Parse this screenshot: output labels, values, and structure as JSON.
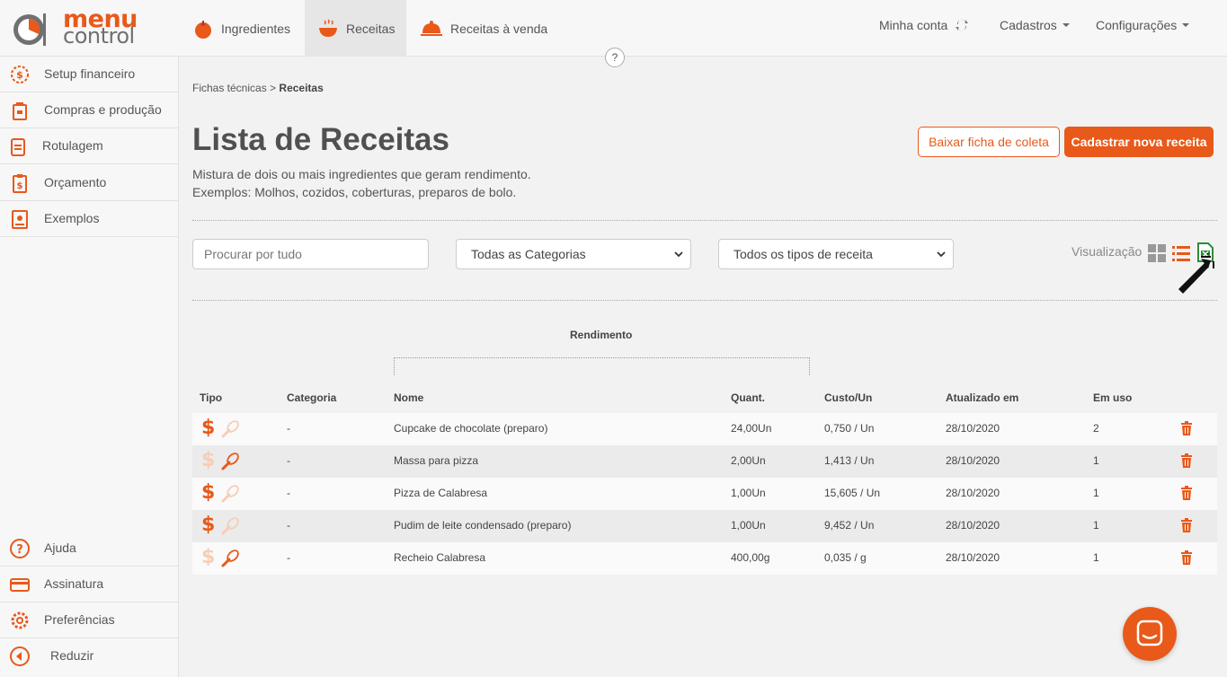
{
  "brand": {
    "line1": "menu",
    "line2": "control",
    "accent": "#e8591a"
  },
  "header": {
    "tabs": [
      {
        "label": "Ingredientes",
        "icon": "tomato-icon"
      },
      {
        "label": "Receitas",
        "icon": "cooking-pot-icon",
        "active": true
      },
      {
        "label": "Receitas à venda",
        "icon": "food-cloche-icon"
      }
    ],
    "account_label": "Minha conta",
    "cadastros_label": "Cadastros",
    "config_label": "Configurações",
    "help_label": "?"
  },
  "sidebar": {
    "top_items": [
      {
        "label": "Setup financeiro",
        "icon": "gear-dollar-icon"
      },
      {
        "label": "Compras e produção",
        "icon": "shopping-bag-icon"
      },
      {
        "label": "Rotulagem",
        "icon": "label-jar-icon"
      },
      {
        "label": "Orçamento",
        "icon": "clipboard-dollar-icon"
      },
      {
        "label": "Exemplos",
        "icon": "recipe-book-icon"
      }
    ],
    "bottom_items": [
      {
        "label": "Ajuda",
        "icon": "help-circle-icon"
      },
      {
        "label": "Assinatura",
        "icon": "credit-card-icon"
      },
      {
        "label": "Preferências",
        "icon": "gear-icon"
      },
      {
        "label": "Reduzir",
        "icon": "collapse-arrow-icon"
      }
    ]
  },
  "breadcrumb": {
    "parent": "Fichas técnicas",
    "separator": ">",
    "current": "Receitas"
  },
  "page": {
    "title": "Lista de Receitas",
    "desc1": "Mistura de dois ou mais ingredientes que geram rendimento.",
    "desc2": "Exemplos: Molhos, cozidos, coberturas, preparos de bolo.",
    "download_button": "Baixar ficha de coleta",
    "new_button": "Cadastrar nova receita"
  },
  "filters": {
    "search_placeholder": "Procurar por tudo",
    "category_selected": "Todas as Categorias",
    "type_selected": "Todos os tipos de receita",
    "view_label": "Visualização"
  },
  "table": {
    "group_header": "Rendimento",
    "headers": {
      "tipo": "Tipo",
      "categoria": "Categoria",
      "nome": "Nome",
      "quant": "Quant.",
      "custo": "Custo/Un",
      "atualizado": "Atualizado em",
      "emuso": "Em uso"
    },
    "rows": [
      {
        "sale": true,
        "prep": false,
        "categoria": "-",
        "nome": "Cupcake de chocolate (preparo)",
        "quant": "24,00Un",
        "custo": "0,750 / Un",
        "atualizado": "28/10/2020",
        "emuso": "2"
      },
      {
        "sale": false,
        "prep": true,
        "categoria": "-",
        "nome": "Massa para pizza",
        "quant": "2,00Un",
        "custo": "1,413 / Un",
        "atualizado": "28/10/2020",
        "emuso": "1"
      },
      {
        "sale": true,
        "prep": false,
        "categoria": "-",
        "nome": "Pizza de Calabresa",
        "quant": "1,00Un",
        "custo": "15,605 / Un",
        "atualizado": "28/10/2020",
        "emuso": "1"
      },
      {
        "sale": true,
        "prep": false,
        "categoria": "-",
        "nome": "Pudim de leite condensado (preparo)",
        "quant": "1,00Un",
        "custo": "9,452 / Un",
        "atualizado": "28/10/2020",
        "emuso": "1"
      },
      {
        "sale": false,
        "prep": true,
        "categoria": "-",
        "nome": "Recheio Calabresa",
        "quant": "400,00g",
        "custo": "0,035 / g",
        "atualizado": "28/10/2020",
        "emuso": "1"
      }
    ]
  },
  "icons": {
    "dollar_glyph": "$",
    "active_color": "#e8591a",
    "faded_color": "#f6cdb8",
    "excel_color": "#2e8b3a"
  }
}
